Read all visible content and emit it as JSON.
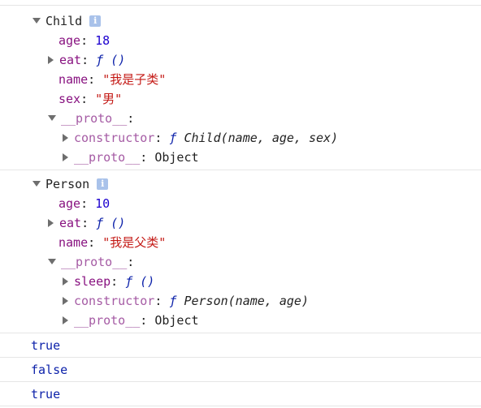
{
  "child": {
    "title": "Child",
    "props": {
      "age_key": "age",
      "age_val": "18",
      "eat_key": "eat",
      "eat_val": "ƒ ()",
      "name_key": "name",
      "name_val": "\"我是子类\"",
      "sex_key": "sex",
      "sex_val": "\"男\""
    },
    "proto": {
      "key": "__proto__",
      "constructor_key": "constructor",
      "constructor_f": "ƒ",
      "constructor_sig": "Child(name, age, sex)",
      "inner_proto_key": "__proto__",
      "inner_proto_val": "Object"
    }
  },
  "person": {
    "title": "Person",
    "props": {
      "age_key": "age",
      "age_val": "10",
      "eat_key": "eat",
      "eat_val": "ƒ ()",
      "name_key": "name",
      "name_val": "\"我是父类\""
    },
    "proto": {
      "key": "__proto__",
      "sleep_key": "sleep",
      "sleep_val": "ƒ ()",
      "constructor_key": "constructor",
      "constructor_f": "ƒ",
      "constructor_sig": "Person(name, age)",
      "inner_proto_key": "__proto__",
      "inner_proto_val": "Object"
    }
  },
  "info_icon": "info-icon",
  "results": [
    "true",
    "false",
    "true"
  ]
}
